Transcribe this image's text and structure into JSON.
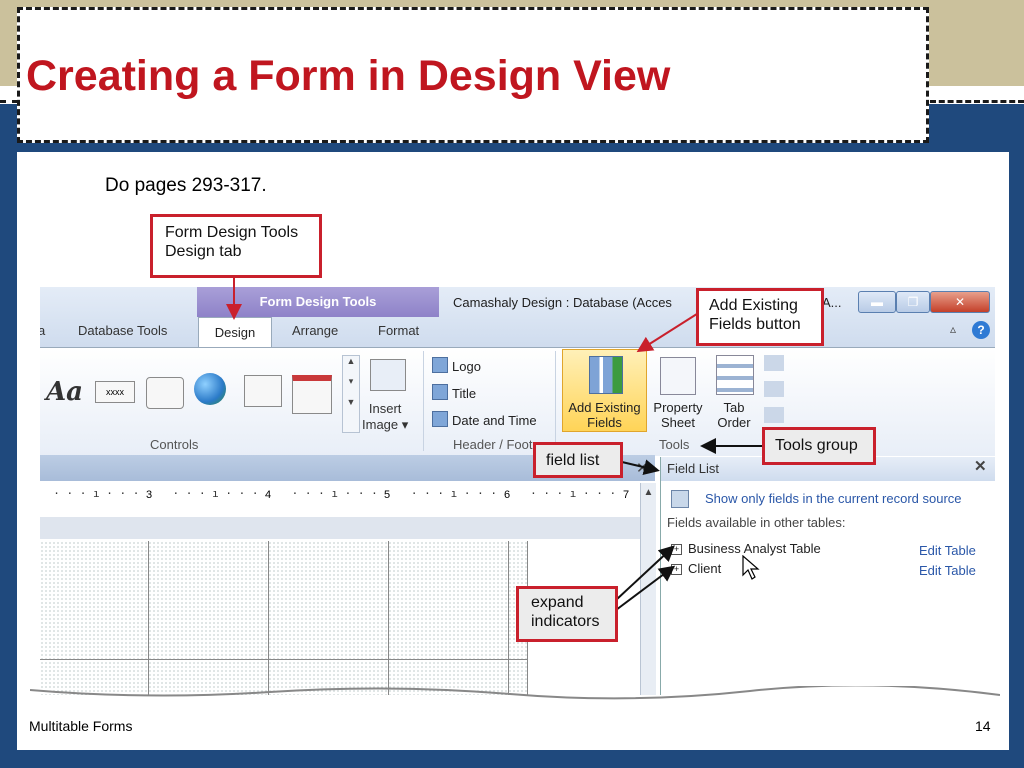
{
  "slide": {
    "title": "Creating a Form in Design View",
    "body_text": "Do pages 293-317.",
    "footer_left": "Multitable Forms",
    "page_number": "14"
  },
  "app": {
    "context_tab": "Form Design Tools",
    "window_title": "Camashaly Design : Database (Acces",
    "window_title_tail": "A...",
    "tabs": [
      "a",
      "Database Tools",
      "Design",
      "Arrange",
      "Format"
    ],
    "active_tab": "Design",
    "window_buttons": [
      "minimize",
      "restore",
      "close"
    ],
    "groups": {
      "controls": "Controls",
      "header_footer": "Header / Foote",
      "tools": "Tools"
    },
    "controls": {
      "aa": "Aa",
      "textbox_label": "xxxx",
      "insert_image": [
        "Insert",
        "Image ▾"
      ]
    },
    "header_footer_items": [
      "Logo",
      "Title",
      "Date and Time"
    ],
    "tools_buttons": [
      {
        "label_line1": "Add Existing",
        "label_line2": "Fields"
      },
      {
        "label_line1": "Property",
        "label_line2": "Sheet"
      },
      {
        "label_line1": "Tab",
        "label_line2": "Order"
      }
    ],
    "ruler_numbers": [
      "3",
      "4",
      "5",
      "6",
      "7"
    ],
    "field_list": {
      "title": "Field List",
      "show_only": "Show only fields in the current record source",
      "available": "Fields available in other tables:",
      "tables": [
        {
          "name": "Business Analyst Table",
          "action": "Edit Table"
        },
        {
          "name": "Client",
          "action": "Edit Table"
        }
      ]
    }
  },
  "callouts": {
    "design_tab": [
      "Form Design Tools",
      "Design tab"
    ],
    "add_existing": [
      "Add Existing",
      "Fields button"
    ],
    "tools_group": "Tools group",
    "field_list": "field list",
    "expand": [
      "expand",
      "indicators"
    ]
  },
  "colors": {
    "title_red": "#c0161f",
    "navy": "#1f497d",
    "tan": "#cbc19c",
    "callout_border": "#c9202c"
  }
}
